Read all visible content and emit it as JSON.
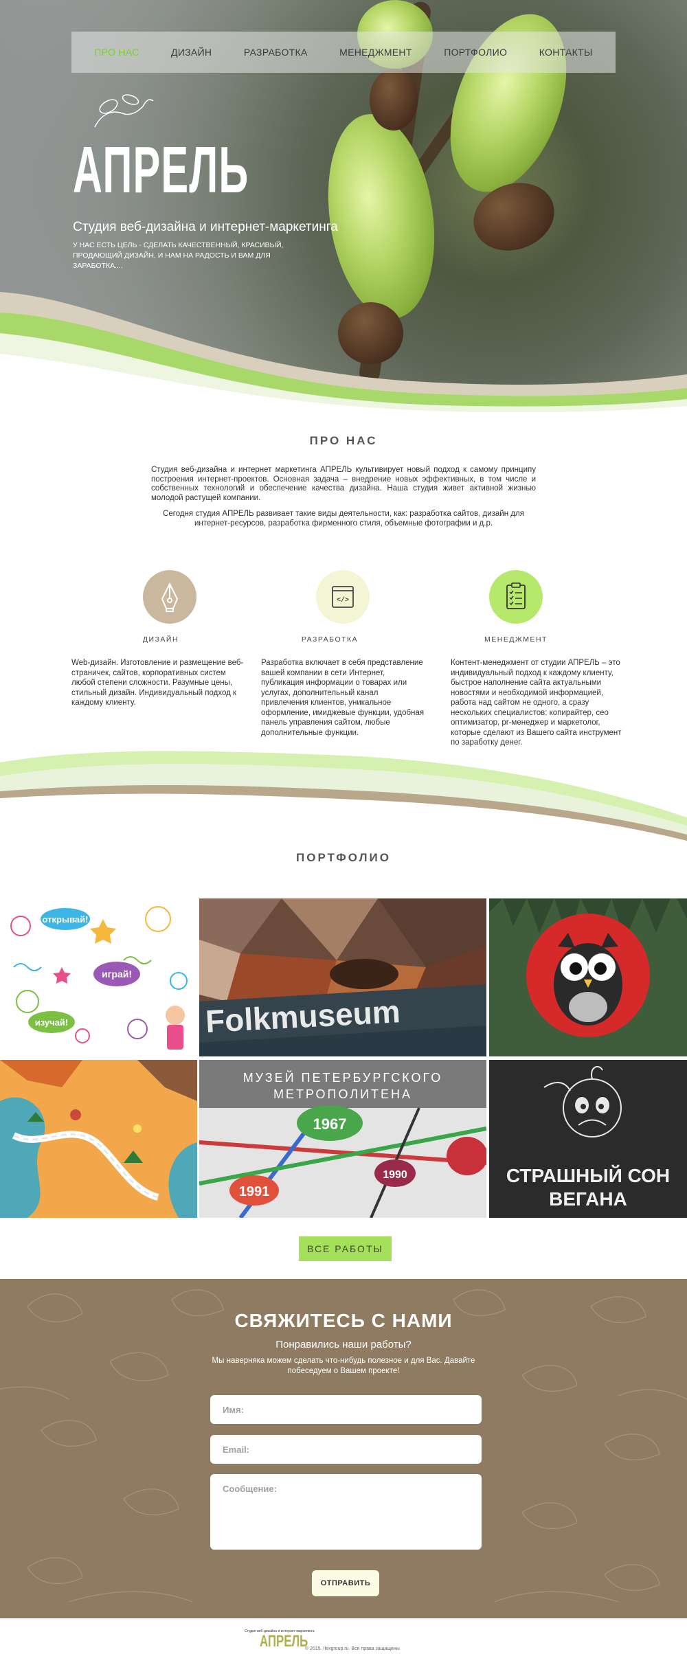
{
  "nav": {
    "items": [
      "ПРО НАС",
      "ДИЗАЙН",
      "РАЗРАБОТКА",
      "МЕНЕДЖМЕНТ",
      "ПОРТФОЛИО",
      "КОНТАКТЫ"
    ],
    "active_index": 0,
    "active_color": "#7bd12e"
  },
  "hero": {
    "title": "АПРЕЛЬ",
    "subtitle": "Студия веб-дизайна и интернет-маркетинга",
    "text": "У нас есть цель - сделать качественный, красивый, продающий дизайн, и нам на радость и вам для заработка...."
  },
  "about": {
    "title": "ПРО НАС",
    "paragraph1": "Студия веб-дизайна и интернет маркетинга АПРЕЛЬ культивирует новый подход к самому принципу построения интернет-проектов. Основная задача – внедрение новых эффективных, в том числе и собственных технологий и обеспечение качества дизайна. Наша студия живет активной жизнью молодой растущей компании.",
    "paragraph2": "Сегодня студия АПРЕЛЬ развивает такие виды деятельности, как: разработка сайтов, дизайн для интернет-ресурсов, разработка фирменного стиля, объемные фотографии и д.р."
  },
  "services": [
    {
      "label": "ДИЗАЙН",
      "icon": "pen-tool-icon",
      "color": "#c9b79e",
      "text": "Web-дизайн. Изготовление и размещение веб-страничек, сайтов, корпоративных систем любой степени сложности. Разумные цены, стильный дизайн. Индивидуальный подход к каждому клиенту."
    },
    {
      "label": "РАЗРАБОТКА",
      "icon": "code-window-icon",
      "color": "#f3f5d4",
      "text": "Разработка включает в себя представление вашей компании в сети Интернет, публикация информации о товарах или услугах, дополнительный канал привлечения клиентов, уникальное оформление, имиджевые функции, удобная панель управления сайтом, любые дополнительные функции."
    },
    {
      "label": "МЕНЕДЖМЕНТ",
      "icon": "checklist-icon",
      "color": "#b6e86c",
      "text": "Контент-менеджмент от студии АПРЕЛЬ – это индивидуальный подход к каждому клиенту, быстрое наполнение сайта актуальными новостями и необходимой информацией, работа над сайтом не одного, а сразу нескольких специалистов: копирайтер, сео оптимизатор, pr-менеджер и маркетолог, которые сделают из Вашего сайта инструмент по заработку денег."
    }
  ],
  "portfolio": {
    "title": "ПОРТФОЛИО",
    "tiles": [
      {
        "name": "kids-illustration",
        "texts": [
          "открывай!",
          "играй!",
          "изучай!"
        ]
      },
      {
        "name": "folkmuseum",
        "texts": [
          "Folkmuseum"
        ]
      },
      {
        "name": "owl-logo",
        "texts": []
      },
      {
        "name": "map-illustration",
        "texts": []
      },
      {
        "name": "metro-museum",
        "texts": [
          "МУЗЕЙ ПЕТЕРБУРГСКОГО",
          "МЕТРОПОЛИТЕНА",
          "1967",
          "1991",
          "1990"
        ]
      },
      {
        "name": "vegan-nightmare",
        "texts": [
          "СТРАШНЫЙ СОН",
          "ВЕГАНА"
        ]
      }
    ],
    "all_works_label": "ВСЕ РАБОТЫ"
  },
  "contact": {
    "title": "СВЯЖИТЕСЬ С НАМИ",
    "subtitle": "Понравились наши работы?",
    "text": "Мы наверняка можем сделать что-нибудь полезное и для Вас. Давайте побеседуем о Вашем проекте!",
    "name_placeholder": "Имя:",
    "email_placeholder": "Email:",
    "message_placeholder": "Сообщение:",
    "send_label": "ОТПРАВИТЬ",
    "bg_color": "#8e7b61"
  },
  "footer": {
    "tagline": "Студия веб-дизайна и интернет-маркетинга",
    "logo": "АПРЕЛЬ",
    "copyright": "© 2015. Ilexgroup.ru. Все права защищены"
  }
}
